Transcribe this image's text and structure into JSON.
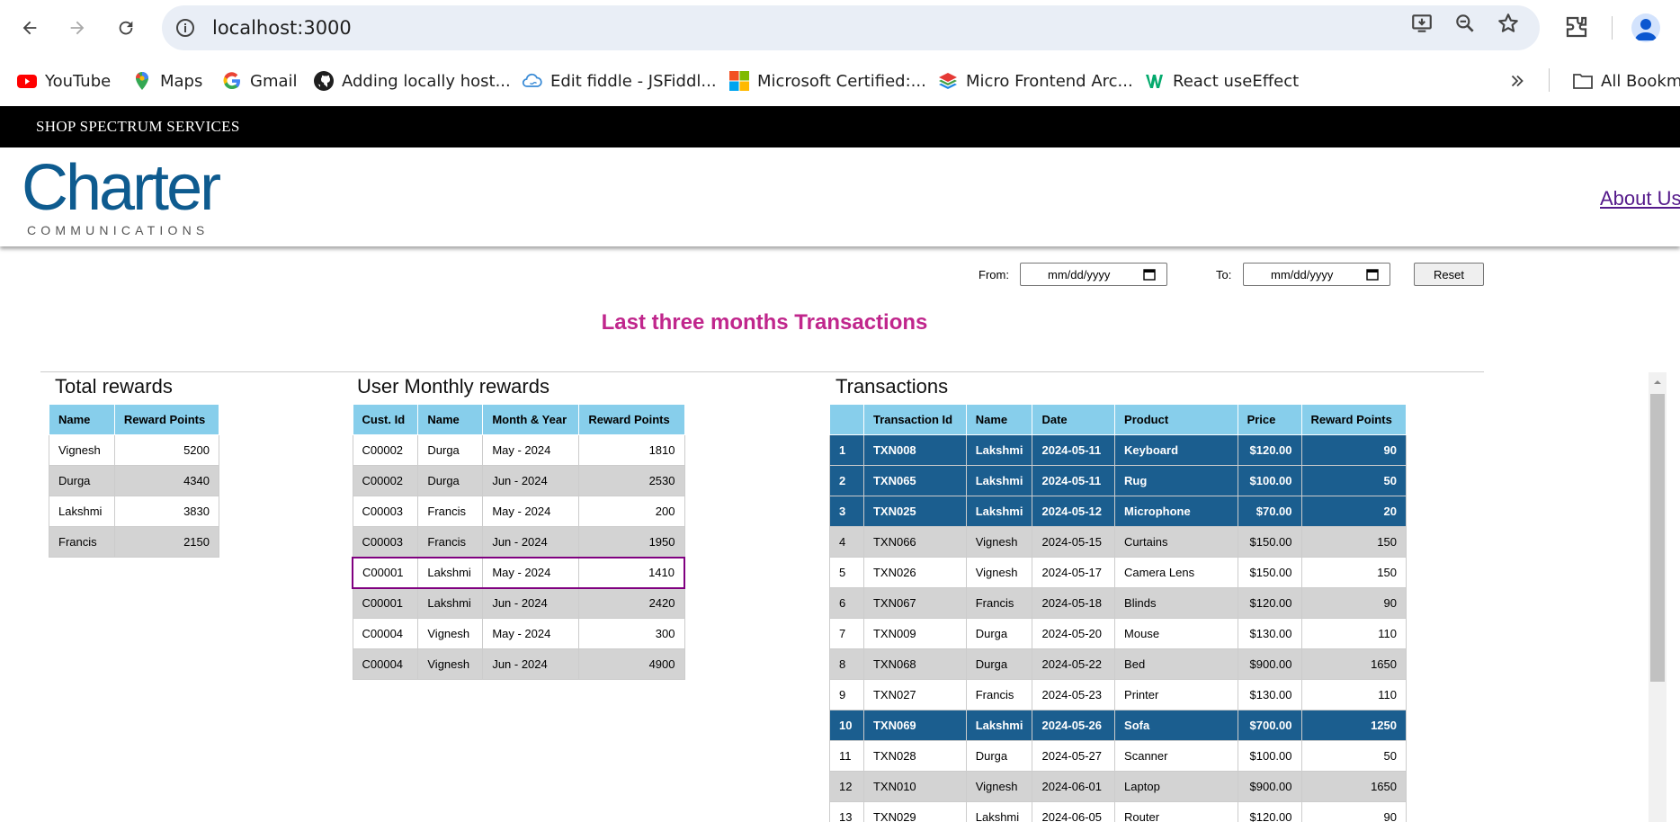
{
  "browser": {
    "url": "localhost:3000",
    "bookmarks": [
      {
        "label": "YouTube",
        "icon": "youtube-icon"
      },
      {
        "label": "Maps",
        "icon": "maps-icon"
      },
      {
        "label": "Gmail",
        "icon": "google-icon"
      },
      {
        "label": "Adding locally host...",
        "icon": "github-icon"
      },
      {
        "label": "Edit fiddle - JSFiddl...",
        "icon": "jsfiddle-icon"
      },
      {
        "label": "Microsoft Certified:...",
        "icon": "microsoft-icon"
      },
      {
        "label": "Micro Frontend Arc...",
        "icon": "layers-icon"
      },
      {
        "label": "React useEffect",
        "icon": "w3schools-icon"
      }
    ],
    "all_bookmarks": "All Bookma"
  },
  "topbar": {
    "title": "SHOP SPECTRUM SERVICES"
  },
  "header": {
    "logo_word": "Charter",
    "logo_sub": "COMMUNICATIONS",
    "about_link": "About Us"
  },
  "filters": {
    "from_label": "From:",
    "to_label": "To:",
    "from_placeholder": "mm/dd/yyyy",
    "to_placeholder": "mm/dd/yyyy",
    "reset_label": "Reset"
  },
  "main": {
    "title": "Last three months Transactions"
  },
  "total_rewards": {
    "title": "Total rewards",
    "columns": [
      "Name",
      "Reward Points"
    ],
    "rows": [
      [
        "Vignesh",
        "5200"
      ],
      [
        "Durga",
        "4340"
      ],
      [
        "Lakshmi",
        "3830"
      ],
      [
        "Francis",
        "2150"
      ]
    ]
  },
  "monthly_rewards": {
    "title": "User Monthly rewards",
    "columns": [
      "Cust. Id",
      "Name",
      "Month & Year",
      "Reward Points"
    ],
    "rows": [
      [
        "C00002",
        "Durga",
        "May - 2024",
        "1810"
      ],
      [
        "C00002",
        "Durga",
        "Jun - 2024",
        "2530"
      ],
      [
        "C00003",
        "Francis",
        "May - 2024",
        "200"
      ],
      [
        "C00003",
        "Francis",
        "Jun - 2024",
        "1950"
      ],
      [
        "C00001",
        "Lakshmi",
        "May - 2024",
        "1410"
      ],
      [
        "C00001",
        "Lakshmi",
        "Jun - 2024",
        "2420"
      ],
      [
        "C00004",
        "Vignesh",
        "May - 2024",
        "300"
      ],
      [
        "C00004",
        "Vignesh",
        "Jun - 2024",
        "4900"
      ]
    ]
  },
  "transactions": {
    "title": "Transactions",
    "columns": [
      "",
      "Transaction Id",
      "Name",
      "Date",
      "Product",
      "Price",
      "Reward Points"
    ],
    "rows": [
      [
        "1",
        "TXN008",
        "Lakshmi",
        "2024-05-11",
        "Keyboard",
        "$120.00",
        "90"
      ],
      [
        "2",
        "TXN065",
        "Lakshmi",
        "2024-05-11",
        "Rug",
        "$100.00",
        "50"
      ],
      [
        "3",
        "TXN025",
        "Lakshmi",
        "2024-05-12",
        "Microphone",
        "$70.00",
        "20"
      ],
      [
        "4",
        "TXN066",
        "Vignesh",
        "2024-05-15",
        "Curtains",
        "$150.00",
        "150"
      ],
      [
        "5",
        "TXN026",
        "Vignesh",
        "2024-05-17",
        "Camera Lens",
        "$150.00",
        "150"
      ],
      [
        "6",
        "TXN067",
        "Francis",
        "2024-05-18",
        "Blinds",
        "$120.00",
        "90"
      ],
      [
        "7",
        "TXN009",
        "Durga",
        "2024-05-20",
        "Mouse",
        "$130.00",
        "110"
      ],
      [
        "8",
        "TXN068",
        "Durga",
        "2024-05-22",
        "Bed",
        "$900.00",
        "1650"
      ],
      [
        "9",
        "TXN027",
        "Francis",
        "2024-05-23",
        "Printer",
        "$130.00",
        "110"
      ],
      [
        "10",
        "TXN069",
        "Lakshmi",
        "2024-05-26",
        "Sofa",
        "$700.00",
        "1250"
      ],
      [
        "11",
        "TXN028",
        "Durga",
        "2024-05-27",
        "Scanner",
        "$100.00",
        "50"
      ],
      [
        "12",
        "TXN010",
        "Vignesh",
        "2024-06-01",
        "Laptop",
        "$900.00",
        "1650"
      ],
      [
        "13",
        "TXN029",
        "Lakshmi",
        "2024-06-05",
        "Router",
        "$120.00",
        "90"
      ]
    ],
    "highlighted_rows": [
      0,
      1,
      2,
      9
    ]
  },
  "colors": {
    "header_blue": "#87ceeb",
    "highlight_row": "#1b5e8f",
    "title_magenta": "#c0268c",
    "selected_outline": "#800080"
  }
}
